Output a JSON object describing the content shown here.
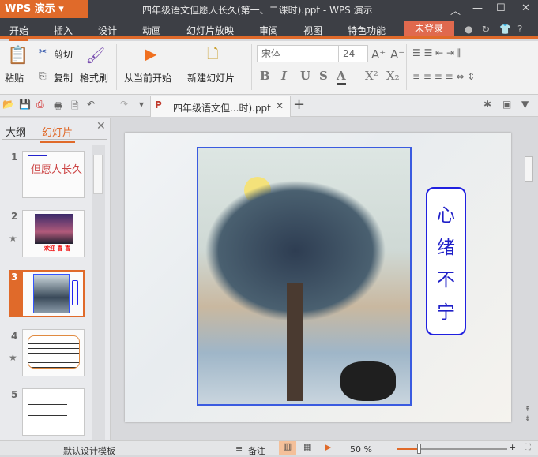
{
  "app": {
    "logo": "WPS 演示",
    "title": "四年级语文但愿人长久(第一、二课时).ppt - WPS 演示"
  },
  "menu": {
    "items": [
      "开始",
      "插入",
      "设计",
      "动画",
      "幻灯片放映",
      "审阅",
      "视图",
      "特色功能"
    ],
    "login": "未登录",
    "help": "?"
  },
  "ribbon": {
    "paste": "粘贴",
    "cut": "剪切",
    "copy": "复制",
    "format_painter": "格式刷",
    "play_from_current": "从当前开始",
    "new_slide": "新建幻灯片",
    "font_name": "宋体",
    "font_size": "24",
    "bold": "B",
    "italic": "I",
    "underline": "U",
    "shadow": "S",
    "font_color": "A"
  },
  "tabs": {
    "doc": "四年级语文但...时).ppt"
  },
  "panel": {
    "tab_outline": "大纲",
    "tab_slides": "幻灯片",
    "slides": [
      {
        "n": "1",
        "title": "但愿人长久"
      },
      {
        "n": "2",
        "caption": "欢迎 喜 喜"
      },
      {
        "n": "3"
      },
      {
        "n": "4"
      },
      {
        "n": "5"
      }
    ]
  },
  "slide": {
    "vertical_text": [
      "心",
      "绪",
      "不",
      "宁"
    ]
  },
  "status": {
    "template": "默认设计模板",
    "notes": "备注",
    "zoom": "50 %"
  },
  "colors": {
    "accent": "#e06a2a",
    "text_blue": "#2020c8"
  }
}
